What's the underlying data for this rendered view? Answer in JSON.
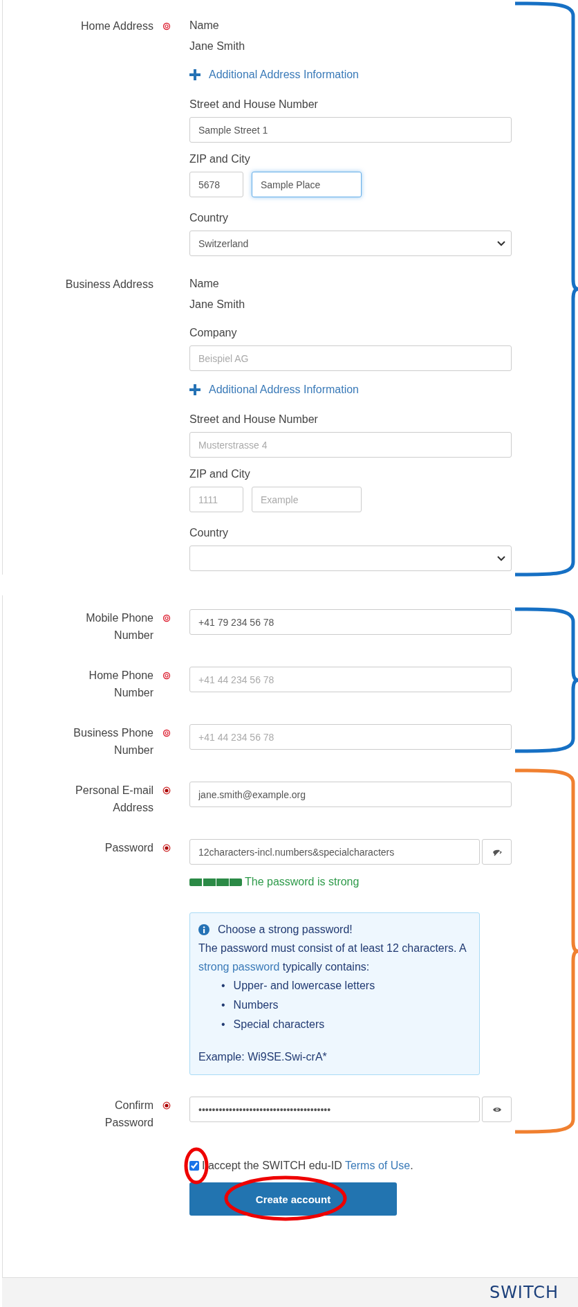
{
  "home_address": {
    "label": "Home Address",
    "kind": "ring",
    "name_label": "Name",
    "name_value": "Jane Smith",
    "additional_link": "Additional Address Information",
    "street_label": "Street and House Number",
    "street": {
      "value": "Sample Street 1"
    },
    "zip_city_label": "ZIP and City",
    "zip": {
      "value": "5678"
    },
    "city": {
      "value": "Sample Place",
      "focused": true
    },
    "country_label": "Country",
    "country": {
      "value": "Switzerland"
    }
  },
  "business_address": {
    "label": "Business Address",
    "name_label": "Name",
    "name_value": "Jane Smith",
    "company_label": "Company",
    "company": {
      "placeholder": "Beispiel AG"
    },
    "additional_link": "Additional Address Information",
    "street_label": "Street and House Number",
    "street": {
      "placeholder": "Musterstrasse 4"
    },
    "zip_city_label": "ZIP and City",
    "zip": {
      "placeholder": "1111"
    },
    "city": {
      "placeholder": "Example"
    },
    "country_label": "Country"
  },
  "phones": [
    {
      "label": "Mobile Phone Number",
      "kind": "ring",
      "value": "+41 79 234 56 78"
    },
    {
      "label": "Home Phone Number",
      "kind": "ring",
      "placeholder": "+41 44 234 56 78"
    },
    {
      "label": "Business Phone Number",
      "kind": "ring",
      "placeholder": "+41 44 234 56 78"
    }
  ],
  "email": {
    "label": "Personal E-mail Address",
    "kind": "dot",
    "value": "jane.smith@example.org"
  },
  "password": {
    "label": "Password",
    "kind": "dot",
    "value": "12characters-incl.numbers&specialcharacters",
    "masked": false,
    "strength": {
      "level": 1,
      "text": "The password is strong"
    }
  },
  "password_hint": {
    "title": "Choose a strong password!",
    "text_before": "The password must consist of at least 12 characters. A ",
    "link": "strong password",
    "text_after": " typically contains:",
    "bullets": [
      {
        "mark": "•",
        "text": "Upper- and lowercase letters"
      },
      {
        "mark": "•",
        "text": "Numbers"
      },
      {
        "mark": "•",
        "text": "Special characters"
      }
    ],
    "example": "Example: Wi9SE.Swi-crA*"
  },
  "confirm_password": {
    "label": "Confirm Password",
    "kind": "dot",
    "value": "•••••••••••••••••••••••••••••••••••••••",
    "masked": true
  },
  "terms": {
    "checked": true,
    "text": "I accept the SWITCH edu-ID ",
    "link": "Terms of Use",
    "text_after": "."
  },
  "submit_button": "Create account",
  "footer": {
    "logo": "SWITCH"
  },
  "annotation_braces": [
    {
      "color": "#1670c4"
    },
    {
      "color": "#1670c4"
    },
    {
      "color": "#f08030"
    }
  ]
}
